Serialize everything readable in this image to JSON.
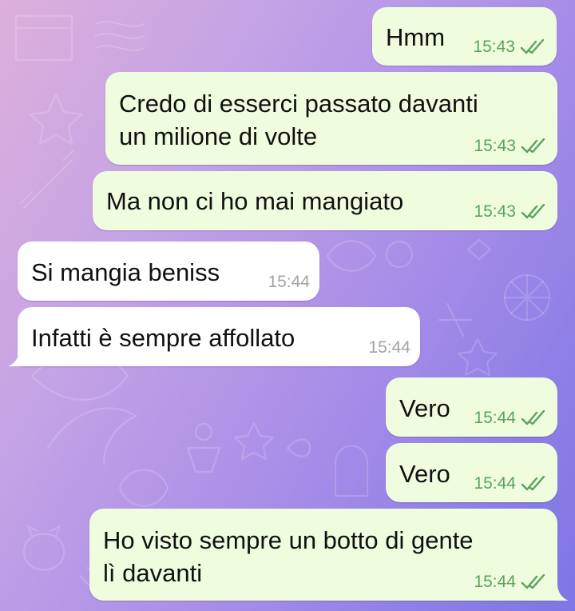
{
  "colors": {
    "outgoing_bubble": "#effdde",
    "incoming_bubble": "#ffffff",
    "outgoing_time": "#5aa35c",
    "incoming_time": "#a3a3a3",
    "read_check": "#5aa35c"
  },
  "messages": [
    {
      "direction": "outgoing",
      "text": "Hmm",
      "time": "15:43",
      "status": "read"
    },
    {
      "direction": "outgoing",
      "text": "Credo di esserci passato davanti",
      "text_2": "un milione di volte",
      "time": "15:43",
      "status": "read"
    },
    {
      "direction": "outgoing",
      "text": "Ma non ci ho mai mangiato",
      "time": "15:43",
      "status": "read"
    },
    {
      "direction": "incoming",
      "text": "Si mangia beniss",
      "time": "15:44"
    },
    {
      "direction": "incoming",
      "text": "Infatti è sempre affollato",
      "time": "15:44"
    },
    {
      "direction": "outgoing",
      "text": "Vero",
      "time": "15:44",
      "status": "read"
    },
    {
      "direction": "outgoing",
      "text": "Vero",
      "time": "15:44",
      "status": "read"
    },
    {
      "direction": "outgoing",
      "text": "Ho visto sempre un botto di gente",
      "text_2": "lì davanti",
      "time": "15:44",
      "status": "read"
    }
  ]
}
